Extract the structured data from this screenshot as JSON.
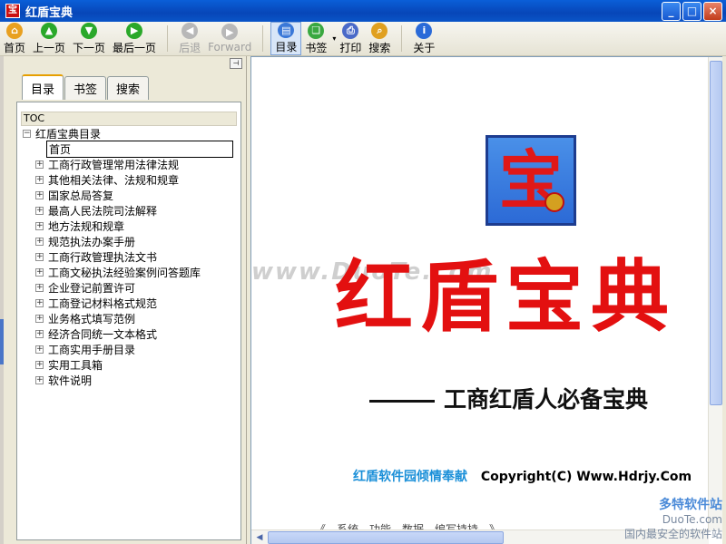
{
  "window": {
    "title": "红盾宝典",
    "app_icon_glyph": "宝"
  },
  "window_controls": {
    "minimize": "_",
    "maximize": "□",
    "close": "×"
  },
  "toolbar": {
    "buttons": [
      {
        "label": "首页",
        "icon": "home-icon",
        "color": "#e8a020",
        "glyph": "⌂",
        "disabled": false
      },
      {
        "label": "上一页",
        "icon": "up-arrow-icon",
        "color": "#2aa82a",
        "glyph": "▲",
        "disabled": false
      },
      {
        "label": "下一页",
        "icon": "down-arrow-icon",
        "color": "#2aa82a",
        "glyph": "▼",
        "disabled": false
      },
      {
        "label": "最后一页",
        "icon": "last-page-icon",
        "color": "#2aa82a",
        "glyph": "▶",
        "disabled": false
      },
      {
        "label": "后退",
        "icon": "back-icon",
        "color": "#b0b0b0",
        "glyph": "◀",
        "disabled": true
      },
      {
        "label": "Forward",
        "icon": "forward-icon",
        "color": "#b0b0b0",
        "glyph": "▶",
        "disabled": true
      },
      {
        "label": "目录",
        "icon": "toc-icon",
        "color": "#3a78d8",
        "glyph": "▤",
        "disabled": false
      },
      {
        "label": "书签",
        "icon": "bookmark-icon",
        "color": "#3aa840",
        "glyph": "❏",
        "disabled": false
      },
      {
        "label": "打印",
        "icon": "print-icon",
        "color": "#4a6ac8",
        "glyph": "⎙",
        "disabled": false
      },
      {
        "label": "搜索",
        "icon": "search-icon",
        "color": "#e0a020",
        "glyph": "⌕",
        "disabled": false
      },
      {
        "label": "关于",
        "icon": "info-icon",
        "color": "#2a6ad8",
        "glyph": "i",
        "disabled": false
      }
    ]
  },
  "tabs": [
    {
      "label": "目录",
      "active": true
    },
    {
      "label": "书签",
      "active": false
    },
    {
      "label": "搜索",
      "active": false
    }
  ],
  "tree": {
    "header": "TOC",
    "root": "红盾宝典目录",
    "selected_leaf": "首页",
    "children": [
      "工商行政管理常用法律法规",
      "其他相关法律、法规和规章",
      "国家总局答复",
      "最高人民法院司法解释",
      "地方法规和规章",
      "规范执法办案手册",
      "工商行政管理执法文书",
      "工商文秘执法经验案例问答题库",
      "企业登记前置许可",
      "工商登记材料格式规范",
      "业务格式填写范例",
      "经济合同统一文本格式",
      "工商实用手册目录",
      "实用工具箱",
      "软件说明"
    ]
  },
  "content": {
    "logo_char": "宝",
    "title": "红盾宝典",
    "watermark": "www.DuoTe.com",
    "slogan": "工商红盾人必备宝典",
    "footer_brand": "红盾软件园倾情奉献",
    "footer_copyright": "Copyright(C) Www.Hdrjy.Com",
    "bottom_cut_text": "《…系统…功能…数据…编写持持…》…"
  },
  "corner_watermark": {
    "main": "多特软件站",
    "site": "DuoTe.com",
    "tagline": "国内最安全的软件站"
  },
  "colors": {
    "title_red": "#e31010",
    "brand_blue": "#1a8fd8",
    "titlebar_blue": "#0a5fd8"
  }
}
